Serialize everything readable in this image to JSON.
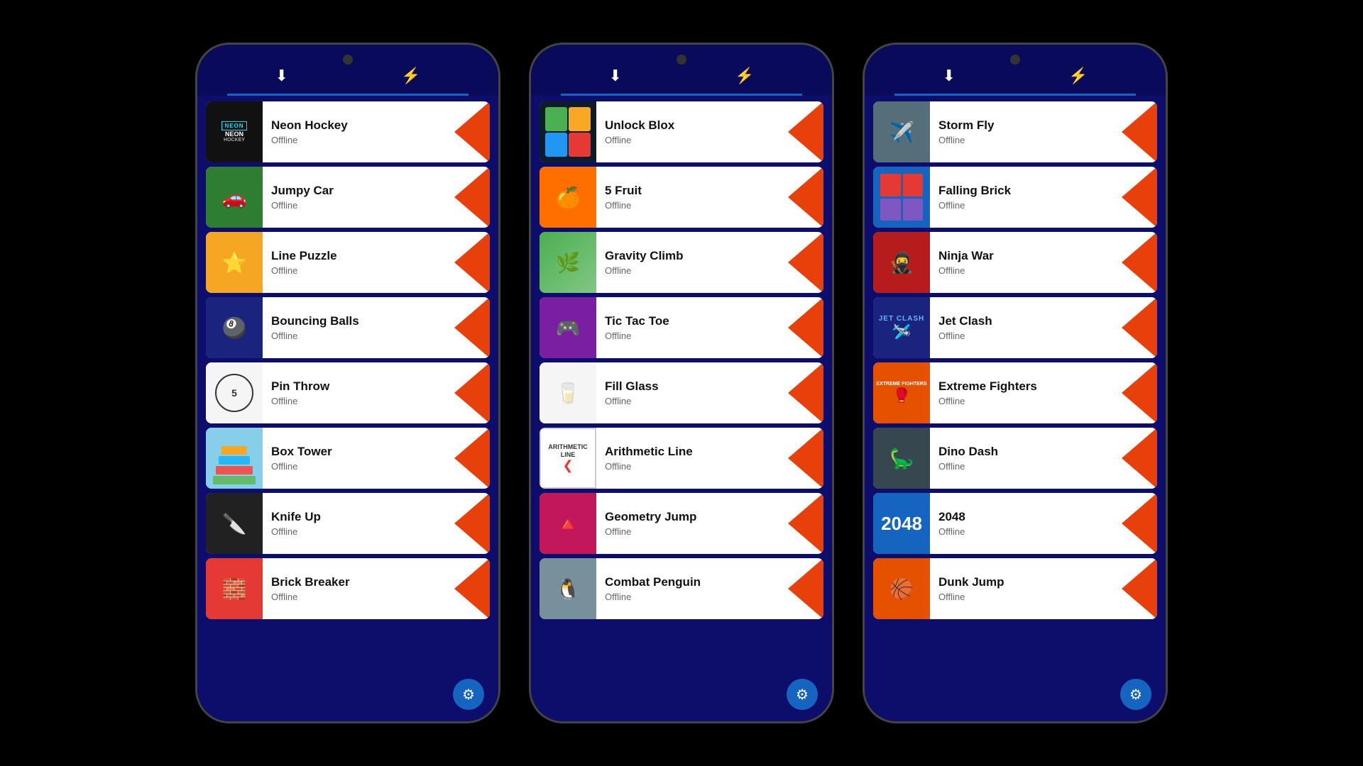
{
  "phones": [
    {
      "id": "phone1",
      "games": [
        {
          "name": "Neon Hockey",
          "status": "Offline",
          "iconType": "neon-hockey",
          "color": "#111"
        },
        {
          "name": "Jumpy Car",
          "status": "Offline",
          "iconType": "emoji",
          "emoji": "🚗",
          "color": "#4caf50"
        },
        {
          "name": "Line Puzzle",
          "status": "Offline",
          "iconType": "star",
          "color": "#f5a623"
        },
        {
          "name": "Bouncing Balls",
          "status": "Offline",
          "iconType": "emoji",
          "emoji": "🎱",
          "color": "#1a237e"
        },
        {
          "name": "Pin Throw",
          "status": "Offline",
          "iconType": "pin",
          "color": "#f5f5f5"
        },
        {
          "name": "Box Tower",
          "status": "Offline",
          "iconType": "box-tower",
          "color": "#87CEEB"
        },
        {
          "name": "Knife Up",
          "status": "Offline",
          "iconType": "emoji",
          "emoji": "🔪",
          "color": "#212121"
        },
        {
          "name": "Brick Breaker",
          "status": "Offline",
          "iconType": "emoji",
          "emoji": "🧱",
          "color": "#e53935"
        }
      ]
    },
    {
      "id": "phone2",
      "games": [
        {
          "name": "Unlock Blox",
          "status": "Offline",
          "iconType": "blocks",
          "color": "#1a237e"
        },
        {
          "name": "5 Fruit",
          "status": "Offline",
          "iconType": "emoji",
          "emoji": "🍊",
          "color": "#ff6f00"
        },
        {
          "name": "Gravity Climb",
          "status": "Offline",
          "iconType": "gravity",
          "color": "#4caf50"
        },
        {
          "name": "Tic Tac Toe",
          "status": "Offline",
          "iconType": "emoji",
          "emoji": "🎮",
          "color": "#7b1fa2"
        },
        {
          "name": "Fill Glass",
          "status": "Offline",
          "iconType": "emoji",
          "emoji": "🥛",
          "color": "#f5f5f5"
        },
        {
          "name": "Arithmetic Line",
          "status": "Offline",
          "iconType": "arith",
          "color": "#fff"
        },
        {
          "name": "Geometry Jump",
          "status": "Offline",
          "iconType": "geo",
          "color": "#c2185b"
        },
        {
          "name": "Combat Penguin",
          "status": "Offline",
          "iconType": "emoji",
          "emoji": "🐧",
          "color": "#78909c"
        }
      ]
    },
    {
      "id": "phone3",
      "games": [
        {
          "name": "Storm Fly",
          "status": "Offline",
          "iconType": "emoji",
          "emoji": "✈️",
          "color": "#546e7a"
        },
        {
          "name": "Falling Brick",
          "status": "Offline",
          "iconType": "emoji",
          "emoji": "🟥",
          "color": "#1565c0"
        },
        {
          "name": "Ninja War",
          "status": "Offline",
          "iconType": "emoji",
          "emoji": "🥷",
          "color": "#b71c1c"
        },
        {
          "name": "Jet Clash",
          "status": "Offline",
          "iconType": "emoji",
          "emoji": "🛩️",
          "color": "#1a237e"
        },
        {
          "name": "Extreme Fighters",
          "status": "Offline",
          "iconType": "emoji",
          "emoji": "🥊",
          "color": "#e65100"
        },
        {
          "name": "Dino Dash",
          "status": "Offline",
          "iconType": "emoji",
          "emoji": "🦕",
          "color": "#37474f"
        },
        {
          "name": "2048",
          "status": "Offline",
          "iconType": "2048",
          "color": "#1565c0"
        },
        {
          "name": "Dunk Jump",
          "status": "Offline",
          "iconType": "emoji",
          "emoji": "🏀",
          "color": "#e65100"
        }
      ]
    }
  ],
  "header": {
    "download_icon": "⬇",
    "bolt_icon": "⚡"
  },
  "settings_icon": "⚙"
}
